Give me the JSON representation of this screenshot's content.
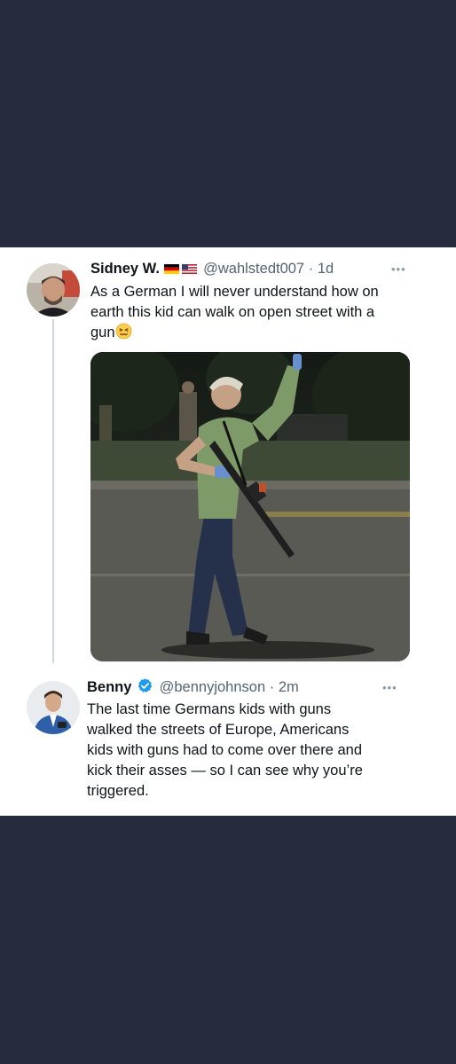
{
  "tweet": {
    "name": "Sidney W.",
    "handle": "@wahlstedt007",
    "sep": "·",
    "time": "1d",
    "more": "•••",
    "text_lines": [
      "As a German I will never understand how on",
      "earth this kid can walk on open street with a",
      "gun"
    ],
    "emoji": "confounded-face-emoji",
    "flags": [
      "germany-flag-icon",
      "usa-flag-icon"
    ]
  },
  "reply": {
    "name": "Benny",
    "handle": "@bennyjohnson",
    "sep": "·",
    "time": "2m",
    "more": "•••",
    "text_lines": [
      "The last time Germans kids with guns",
      "walked the streets of Europe, Americans",
      "kids with guns had to come over there and",
      "kick their asses — so I can see why you’re",
      "triggered."
    ]
  },
  "colors": {
    "background": "#262b3d",
    "card": "#ffffff",
    "text": "#0f1419",
    "secondary": "#536471",
    "verified": "#1d9bf0"
  }
}
